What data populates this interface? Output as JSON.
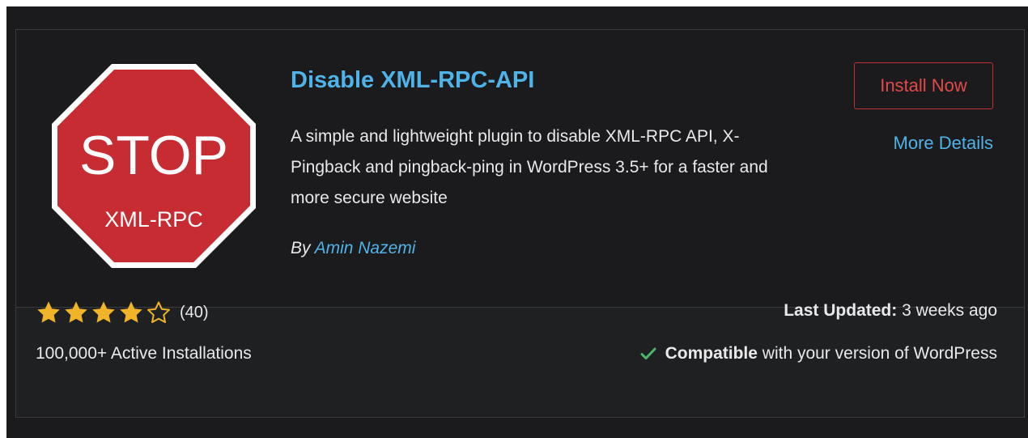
{
  "plugin": {
    "title": "Disable XML-RPC-API",
    "description": "A simple and lightweight plugin to disable XML-RPC API, X-Pingback and pingback-ping in WordPress 3.5+ for a faster and more secure website",
    "author_prefix": "By ",
    "author_name": "Amin Nazemi",
    "icon": {
      "name": "stop-sign-icon",
      "main_text": "STOP",
      "sub_text": "XML-RPC",
      "color": "#c72c33"
    }
  },
  "actions": {
    "install_label": "Install Now",
    "more_details_label": "More Details"
  },
  "stats": {
    "rating_stars": 4,
    "rating_max": 5,
    "rating_count": "(40)",
    "active_installs": "100,000+ Active Installations",
    "last_updated_label": "Last Updated:",
    "last_updated_value": " 3 weeks ago",
    "compat_strong": "Compatible",
    "compat_rest": " with your version of WordPress"
  },
  "colors": {
    "accent_link": "#4fb3e8",
    "install_red": "#e34a47",
    "star_gold": "#f0b429",
    "check_green": "#4ab866",
    "card_bg": "#1b1b1d"
  }
}
